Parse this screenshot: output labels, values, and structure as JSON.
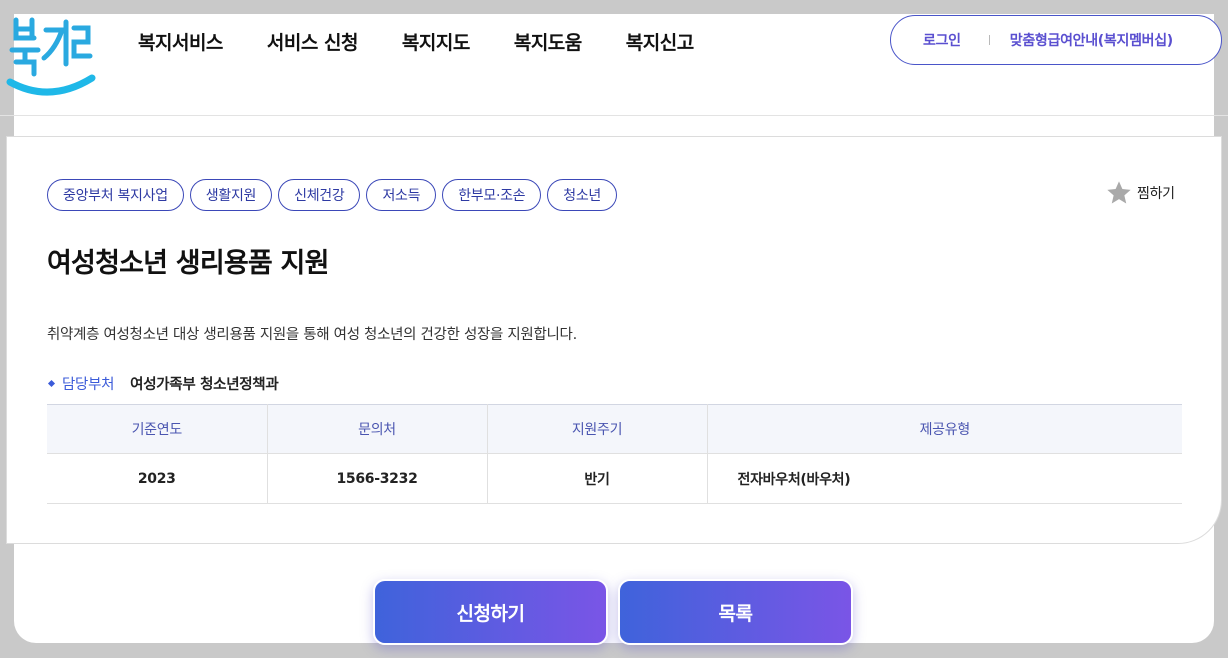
{
  "header": {
    "logo_text": "복지로",
    "nav": [
      "복지서비스",
      "서비스 신청",
      "복지지도",
      "복지도움",
      "복지신고"
    ],
    "login": "로그인",
    "membership": "맞춤형급여안내(복지멤버십)"
  },
  "service": {
    "tags": [
      "중앙부처 복지사업",
      "생활지원",
      "신체건강",
      "저소득",
      "한부모·조손",
      "청소년"
    ],
    "wish_label": "찜하기",
    "title": "여성청소년 생리용품 지원",
    "description": "취약계층 여성청소년 대상 생리용품 지원을 통해 여성 청소년의 건강한 성장을 지원합니다.",
    "dept_label": "담당부처",
    "dept_value": "여성가족부 청소년정책과",
    "table": {
      "headers": [
        "기준연도",
        "문의처",
        "지원주기",
        "제공유형"
      ],
      "row": [
        "2023",
        "1566-3232",
        "반기",
        "전자바우처(바우처)"
      ]
    }
  },
  "actions": {
    "apply": "신청하기",
    "list": "목록"
  },
  "colors": {
    "accent": "#3b48b8",
    "button_gradient_start": "#3f63db",
    "button_gradient_end": "#7a55e6"
  }
}
